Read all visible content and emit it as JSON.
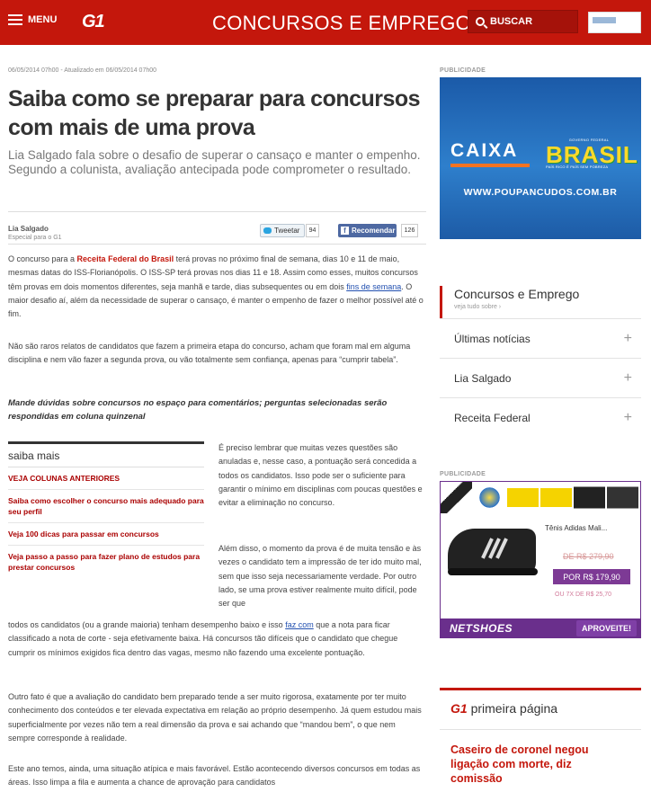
{
  "header": {
    "menu_label": "MENU",
    "logo": "G1",
    "section_title": "CONCURSOS E EMPREGO",
    "search_label": "BUSCAR"
  },
  "article": {
    "dates": "06/05/2014 07h00 - Atualizado em 06/05/2014 07h00",
    "headline": "Saiba como se preparar para concursos com mais de uma prova",
    "subtitle_line1": "Lia Salgado fala sobre o desafio de superar o cansaço e manter o empenho.",
    "subtitle_line2": "Segundo a colunista, avaliação antecipada pode comprometer o resultado.",
    "author": "Lia Salgado",
    "author_role": "Especial para o G1",
    "tweet_label": "Tweetar",
    "tweet_count": "94",
    "fb_label": "Recomendar",
    "fb_count": "126",
    "p1_a": "O concurso para a ",
    "p1_link": "Receita Federal do Brasil",
    "p1_b": " terá provas no próximo final de semana, dias 10 e 11 de maio, mesmas datas do ISS-Florianópolis. O ISS-SP terá provas nos dias 11 e 18. Assim como esses, muitos concursos têm provas em dois momentos diferentes, seja manhã e tarde, dias subsequentes ou em dois ",
    "p1_link2": "fins de semana",
    "p1_c": ". O maior desafio aí, além da necessidade de superar o cansaço, é manter o empenho de fazer o melhor possível até o fim.",
    "p2": "Não são raros relatos de candidatos que fazem a primeira etapa do concurso, acham que foram mal em alguma disciplina e nem vão fazer a segunda prova, ou vão totalmente sem confiança, apenas para “cumprir tabela”.",
    "p3": "Mande dúvidas sobre concursos no espaço para comentários; perguntas selecionadas serão respondidas em coluna quinzenal",
    "p4": "É preciso lembrar que muitas vezes questões são anuladas e, nesse caso, a pontuação será concedida a todos os candidatos. Isso pode ser o suficiente para garantir o mínimo em disciplinas com poucas questões e evitar a eliminação no concurso.",
    "p5": "Além disso, o momento da prova é de muita tensão e às vezes o candidato tem a impressão de ter ido muito mal, sem que isso seja necessariamente verdade. Por outro lado, se uma prova estiver realmente muito difícil, pode ser que",
    "p6_a": "todos os candidatos (ou a grande maioria) tenham desempenho baixo e isso ",
    "p6_link": "faz com",
    "p6_b": " que a nota para ficar classificado  a nota de corte - seja efetivamente baixa. Há concursos tão difíceis que o candidato que chegue cumprir os mínimos exigidos fica dentro das vagas, mesmo não fazendo uma excelente pontuação.",
    "p7": "Outro fato é que a avaliação do candidato bem preparado tende a ser muito rigorosa, exatamente por ter muito conhecimento dos conteúdos e ter elevada expectativa em relação ao próprio desempenho. Já quem estudou mais superficialmente por vezes não tem a real dimensão da prova e sai achando que “mandou bem”, o que nem sempre corresponde à realidade.",
    "p8": "Este ano temos, ainda, uma situação atípica e mais favorável. Estão acontecendo diversos concursos em todas as áreas. Isso limpa a fila e aumenta a chance de aprovação para candidatos"
  },
  "saiba_mais": {
    "title": "saiba mais",
    "items": [
      "VEJA COLUNAS ANTERIORES",
      "Saiba como escolher o concurso mais adequado para seu perfil",
      "Veja 100 dicas para passar em concursos",
      "Veja passo a passo para fazer plano de estudos para prestar concursos"
    ]
  },
  "sidebar": {
    "pub_label": "PUBLICIDADE",
    "caixa_ad": {
      "brand": "CAIXA",
      "gov_label": "GOVERNO FEDERAL",
      "brasil": "BRASIL",
      "brasil_slogan": "PAÍS RICO É PAÍS SEM POBREZA",
      "url": "WWW.POUPANCUDOS.COM.BR"
    },
    "ce_box": {
      "title": "Concursos e Emprego",
      "subtitle": "veja tudo sobre ›",
      "rows": [
        "Últimas notícias",
        "Lia Salgado",
        "Receita Federal"
      ],
      "expand_glyph": "+"
    },
    "netshoes_ad": {
      "product": "Tênis Adidas Mali...",
      "price_old": "DE R$ 279,90",
      "price_new": "POR R$ 179,90",
      "installments": "OU 7X DE R$ 25,70",
      "logo": "NETSHOES",
      "cta": "APROVEITE!"
    },
    "g1_box": {
      "title_brand": "G1",
      "title_rest": " primeira página",
      "headline": "Caseiro de coronel negou ligação com morte, diz comissão"
    }
  },
  "colors": {
    "brand_red": "#c4170c",
    "netshoes_purple": "#6a2f8c",
    "caixa_blue": "#1b5aa8"
  }
}
